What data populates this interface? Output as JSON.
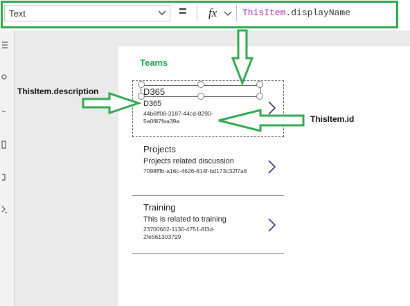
{
  "formula_bar": {
    "property": "Text",
    "equals": "=",
    "fx_label": "fx",
    "formula_keyword": "ThisItem",
    "formula_rest": ".displayName"
  },
  "screen": {
    "title": "Teams"
  },
  "gallery": {
    "rows": [
      {
        "title": "D365",
        "description": "D365",
        "id": "44b6ff08-3187-44cd-8290-5a0f87faa39a"
      },
      {
        "title": "Projects",
        "description": "Projects related discussion",
        "id": "7098fffb-a16c-4626-814f-bd173c32f7a8"
      },
      {
        "title": "Training",
        "description": "This is related to training",
        "id": "23700662-1130-4751-8f3d-2fe561303799"
      }
    ]
  },
  "annotations": {
    "description_label": "ThisItem.description",
    "id_label": "ThisItem.id"
  },
  "colors": {
    "accent_green": "#2fa84f",
    "formula_keyword": "#b0279b",
    "chevron": "#3b2a7a"
  }
}
